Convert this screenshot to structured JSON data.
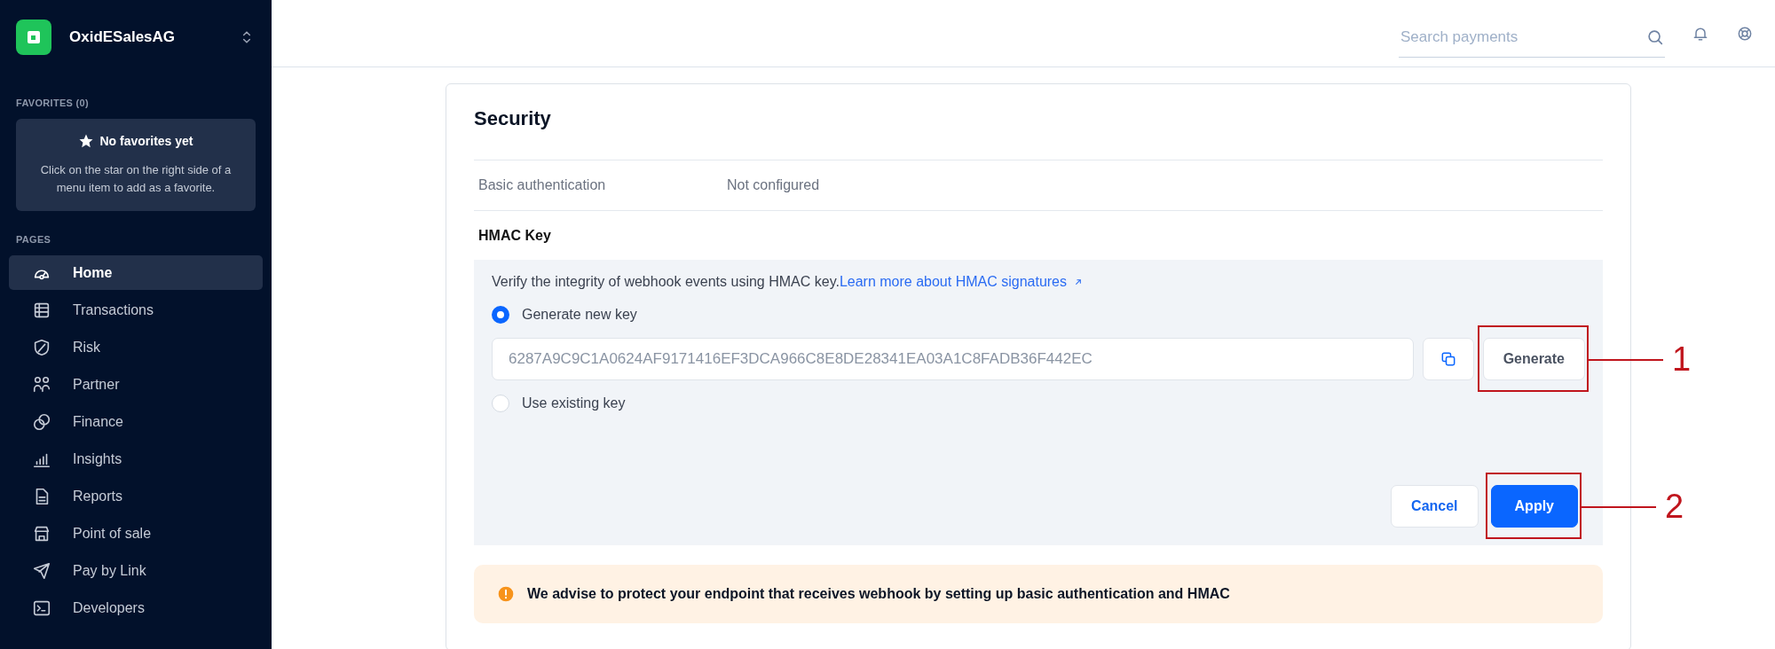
{
  "sidebar": {
    "account": "OxidESalesAG",
    "favorites_heading": "FAVORITES (0)",
    "favorites_empty": {
      "title": "No favorites yet",
      "text": "Click on the star on the right side of a menu item to add as a favorite."
    },
    "pages_heading": "PAGES",
    "items": [
      {
        "label": "Home",
        "selected": true
      },
      {
        "label": "Transactions",
        "selected": false
      },
      {
        "label": "Risk",
        "selected": false
      },
      {
        "label": "Partner",
        "selected": false
      },
      {
        "label": "Finance",
        "selected": false
      },
      {
        "label": "Insights",
        "selected": false
      },
      {
        "label": "Reports",
        "selected": false
      },
      {
        "label": "Point of sale",
        "selected": false
      },
      {
        "label": "Pay by Link",
        "selected": false
      },
      {
        "label": "Developers",
        "selected": false
      }
    ]
  },
  "topbar": {
    "search": {
      "placeholder": "Search payments"
    }
  },
  "security": {
    "title": "Security",
    "rows": [
      {
        "label": "Basic authentication",
        "value": "Not configured"
      }
    ],
    "hmac": {
      "title": "HMAC Key",
      "description": "Verify the integrity of webhook events using HMAC key.",
      "link": "Learn more about HMAC signatures",
      "options": [
        {
          "label": "Generate new key",
          "selected": true
        },
        {
          "label": "Use existing key",
          "selected": false
        }
      ],
      "key_value": "6287A9C9C1A0624AF9171416EF3DCA966C8E8DE28341EA03A1C8FADB36F442EC",
      "generate_button": {
        "label": "Generate",
        "callout": "1"
      },
      "cancel_button": {
        "label": "Cancel"
      },
      "apply_button": {
        "label": "Apply",
        "callout": "2"
      }
    },
    "warning": "We advise to protect your endpoint that receives webhook by setting up basic authentication and HMAC"
  }
}
